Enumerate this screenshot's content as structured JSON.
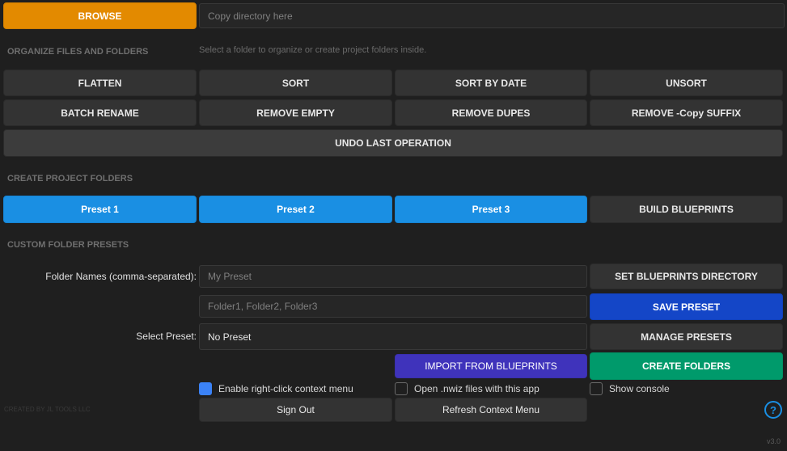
{
  "top": {
    "browse_label": "BROWSE",
    "directory_placeholder": "Copy directory here"
  },
  "organize": {
    "section_title": "ORGANIZE FILES AND FOLDERS",
    "hint": "Select a folder to organize or create project folders inside.",
    "buttons": [
      "FLATTEN",
      "SORT",
      "SORT BY DATE",
      "UNSORT",
      "BATCH RENAME",
      "REMOVE EMPTY",
      "REMOVE DUPES",
      "REMOVE -Copy SUFFIX"
    ],
    "undo_label": "UNDO LAST OPERATION"
  },
  "project": {
    "section_title": "CREATE PROJECT FOLDERS",
    "presets": [
      "Preset 1",
      "Preset 2",
      "Preset 3"
    ],
    "build_blueprints_label": "BUILD BLUEPRINTS"
  },
  "custom": {
    "section_title": "CUSTOM FOLDER PRESETS",
    "folder_names_label": "Folder Names (comma-separated):",
    "preset_name_placeholder": "My Preset",
    "folders_placeholder": "Folder1, Folder2, Folder3",
    "select_preset_label": "Select Preset:",
    "selected_preset": "No Preset",
    "set_blueprints_dir_label": "SET BLUEPRINTS DIRECTORY",
    "save_preset_label": "SAVE PRESET",
    "manage_presets_label": "MANAGE PRESETS",
    "import_label": "IMPORT FROM BLUEPRINTS",
    "create_folders_label": "CREATE FOLDERS"
  },
  "options": {
    "context_menu_label": "Enable right-click context menu",
    "context_menu_checked": true,
    "nwiz_label": "Open .nwiz files with this app",
    "nwiz_checked": false,
    "console_label": "Show console",
    "console_checked": false
  },
  "footer": {
    "credit": "CREATED BY JL TOOLS LLC",
    "sign_out_label": "Sign Out",
    "refresh_label": "Refresh Context Menu",
    "help_glyph": "?",
    "version": "v3.0"
  },
  "colors": {
    "accent_orange": "#e38a00",
    "preset_blue": "#1a8fe3",
    "save_blue": "#1446c7",
    "import_purple": "#3f33bb",
    "create_green": "#009a6b",
    "background": "#1f1f1f"
  }
}
